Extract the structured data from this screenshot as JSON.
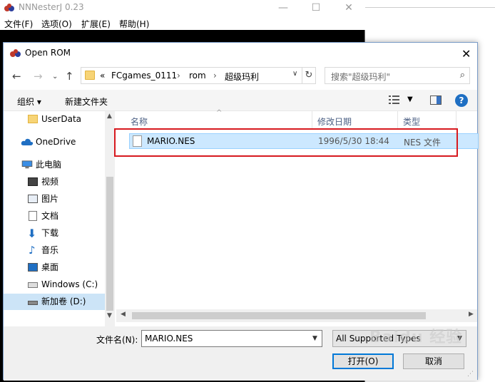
{
  "background_app": {
    "title": "NNNesterJ 0.23",
    "menu": [
      "文件(F)",
      "选项(O)",
      "扩展(E)",
      "帮助(H)"
    ]
  },
  "dialog": {
    "title": "Open ROM",
    "address": {
      "prefix": "«",
      "crumbs": [
        "FCgames_0111",
        "rom",
        "超级玛利"
      ]
    },
    "search_placeholder": "搜索\"超级玛利\"",
    "commands": {
      "organize": "组织 ▾",
      "new_folder": "新建文件夹"
    },
    "nav_items": [
      {
        "label": "UserData",
        "icon": "folder-icon"
      },
      {
        "label": "OneDrive",
        "icon": "cloud-icon"
      },
      {
        "label": "此电脑",
        "icon": "computer-icon"
      },
      {
        "label": "视频",
        "icon": "video-icon"
      },
      {
        "label": "图片",
        "icon": "picture-icon"
      },
      {
        "label": "文档",
        "icon": "document-icon"
      },
      {
        "label": "下载",
        "icon": "download-icon"
      },
      {
        "label": "音乐",
        "icon": "music-icon"
      },
      {
        "label": "桌面",
        "icon": "desktop-icon"
      },
      {
        "label": "Windows (C:)",
        "icon": "drive-icon"
      },
      {
        "label": "新加卷 (D:)",
        "icon": "drive-icon"
      }
    ],
    "columns": {
      "name": "名称",
      "modified": "修改日期",
      "type": "类型"
    },
    "files": [
      {
        "name": "MARIO.NES",
        "modified": "1996/5/30 18:44",
        "type": "NES 文件"
      }
    ],
    "filename_label": "文件名(N):",
    "filename_value": "MARIO.NES",
    "filetype_value": "All Supported Types",
    "open_button": "打开(O)",
    "cancel_button": "取消"
  },
  "watermark": "Baidu 经验",
  "accent_color": "#0078d7",
  "highlight_color": "#d7191f"
}
